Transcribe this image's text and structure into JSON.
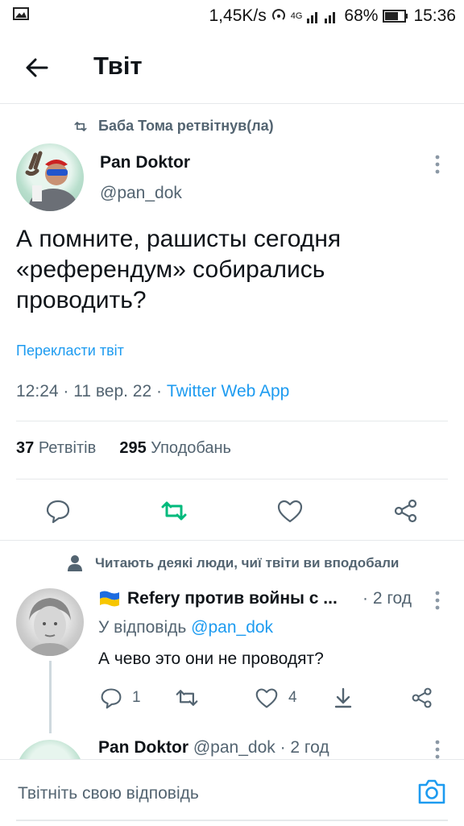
{
  "status_bar": {
    "speed": "1,45K/s",
    "network": "4G",
    "battery": "68%",
    "time": "15:36"
  },
  "header": {
    "back_icon": "arrow-left-icon",
    "title": "Твіт"
  },
  "retweet_context": {
    "icon": "retweet-icon",
    "text": "Баба Тома ретвітнув(ла)"
  },
  "tweet": {
    "author_name": "Pan Doktor",
    "author_handle": "@pan_dok",
    "text_lines": [
      "А помните, рашисты сегодня",
      "«референдум» собирались",
      "проводить?"
    ],
    "translate_label": "Перекласти твіт",
    "time_date": "12:24 · 11 вер. 22 · ",
    "source": "Twitter Web App",
    "retweets_count": "37",
    "retweets_label": "Ретвітів",
    "likes_count": "295",
    "likes_label": "Уподобань",
    "accent_color": "#1d9bf0",
    "retweet_color": "#00ba7c"
  },
  "reply_section": {
    "note": "Читають деякі люди, чиї твіти ви вподобали",
    "reply": {
      "flag_icon": "ukraine-flag-icon",
      "author_name": "Refery против войны с ...",
      "time": "· 2 год",
      "reply_to_prefix": "У відповідь ",
      "reply_to_handle": "@pan_dok",
      "text": "А чево это они не проводят?",
      "reply_count": "1",
      "like_count": "4"
    },
    "next_reply": {
      "author_name": "Pan Doktor",
      "meta": "@pan_dok · 2 год"
    }
  },
  "compose": {
    "placeholder": "Твітніть свою відповідь",
    "camera_icon": "camera-icon"
  }
}
